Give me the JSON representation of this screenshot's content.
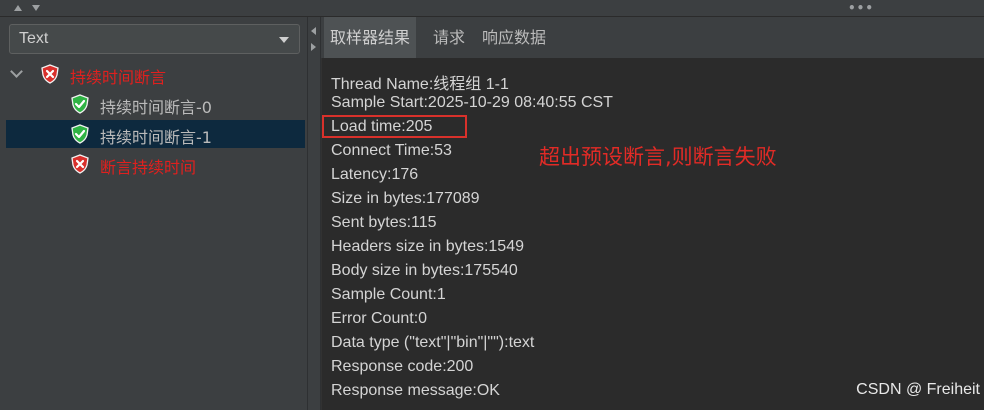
{
  "combo": {
    "value": "Text"
  },
  "tree": {
    "parent_label": "持续时间断言",
    "children": [
      {
        "label": "持续时间断言-0",
        "status": "pass"
      },
      {
        "label": "持续时间断言-1",
        "status": "pass"
      },
      {
        "label": "断言持续时间",
        "status": "fail"
      }
    ]
  },
  "tabs": [
    {
      "label": "取样器结果",
      "active": true
    },
    {
      "label": "请求"
    },
    {
      "label": "响应数据"
    }
  ],
  "result_lines": [
    "Thread Name:线程组 1-1",
    "Sample Start:2025-10-29 08:40:55 CST",
    "Load time:205",
    "Connect Time:53",
    "Latency:176",
    "Size in bytes:177089",
    "Sent bytes:115",
    "Headers size in bytes:1549",
    "Body size in bytes:175540",
    "Sample Count:1",
    "Error Count:0",
    "Data type (\"text\"|\"bin\"|\"\"):text",
    "Response code:200",
    "Response message:OK"
  ],
  "annotation": "超出预设断言,则断言失败",
  "watermark": "CSDN @ Freiheit",
  "colors": {
    "pass": "#2fb344",
    "fail": "#d8302c",
    "annotation": "#e22b26"
  },
  "icons": {
    "pass": "shield-check-icon",
    "fail": "shield-x-icon"
  }
}
